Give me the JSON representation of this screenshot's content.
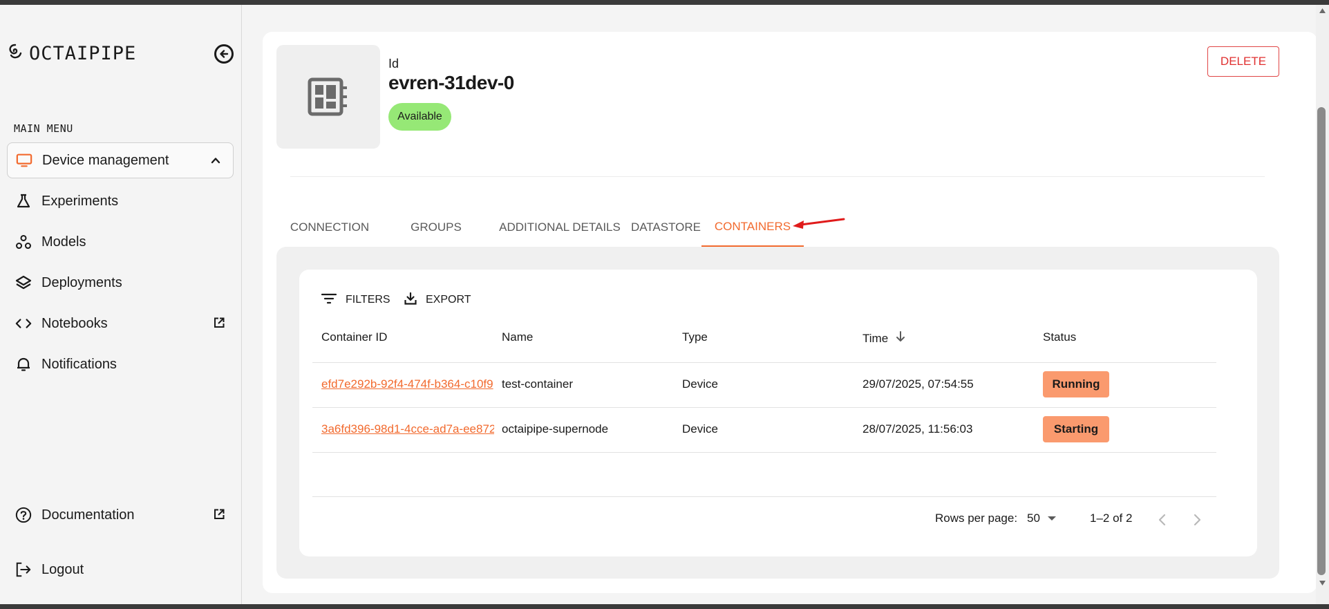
{
  "app": {
    "logo_text": "OCTAIPIPE"
  },
  "sidebar": {
    "menu_title": "MAIN MENU",
    "items": [
      {
        "label": "Device management"
      },
      {
        "label": "Experiments"
      },
      {
        "label": "Models"
      },
      {
        "label": "Deployments"
      },
      {
        "label": "Notebooks"
      },
      {
        "label": "Notifications"
      }
    ],
    "bottom_items": [
      {
        "label": "Documentation"
      },
      {
        "label": "Logout"
      }
    ]
  },
  "device": {
    "id_label": "Id",
    "name": "evren-31dev-0",
    "status": "Available",
    "delete_label": "DELETE"
  },
  "tabs": [
    {
      "label": "CONNECTION"
    },
    {
      "label": "GROUPS"
    },
    {
      "label": "ADDITIONAL DETAILS"
    },
    {
      "label": "DATASTORE"
    },
    {
      "label": "CONTAINERS"
    }
  ],
  "toolbar": {
    "filters_label": "FILTERS",
    "export_label": "EXPORT"
  },
  "table": {
    "headers": [
      "Container ID",
      "Name",
      "Type",
      "Time",
      "Status"
    ],
    "rows": [
      {
        "container_id": "efd7e292b-92f4-474f-b364-c10f9",
        "name": "test-container",
        "type": "Device",
        "time": "29/07/2025, 07:54:55",
        "status": "Running"
      },
      {
        "container_id": "3a6fd396-98d1-4cce-ad7a-ee872",
        "name": "octaipipe-supernode",
        "type": "Device",
        "time": "28/07/2025, 11:56:03",
        "status": "Starting"
      }
    ]
  },
  "pagination": {
    "rows_per_page_label": "Rows per page:",
    "rows_per_page_value": "50",
    "range_text": "1–2 of 2"
  },
  "colors": {
    "accent": "#f26a2e",
    "available": "#96e876",
    "status_chip": "#fa9a6e",
    "delete": "#e03030"
  }
}
